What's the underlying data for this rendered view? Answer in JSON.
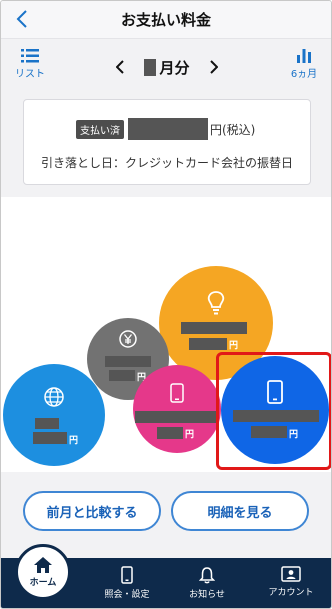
{
  "header": {
    "title": "お支払い料金"
  },
  "monthbar": {
    "list_label": "リスト",
    "month_suffix": "月分",
    "six_label": "6ヵ月"
  },
  "payment": {
    "status_badge": "支払い済",
    "tax_label": "円(税込)",
    "debit_info": "引き落とし日：クレジットカード会社の振替日"
  },
  "bubbles": {
    "yen_symbol": "円",
    "icons": [
      "lightbulb-icon",
      "yen-coin-icon",
      "smartphone-icon",
      "globe-icon",
      "smartphone-icon"
    ],
    "colors": {
      "electricity": "#f5a623",
      "other": "#727272",
      "mobile_small": "#e5388a",
      "internet": "#1d8fe0",
      "mobile_large": "#0f66e6"
    }
  },
  "buttons": {
    "compare": "前月と比較する",
    "detail": "明細を見る"
  },
  "nav": {
    "home": "ホーム",
    "inquiry": "照会・設定",
    "notice": "お知らせ",
    "account": "アカウント"
  },
  "colors": {
    "accent": "#1a73c8",
    "nav_bg": "#0e2a4b",
    "highlight": "#e11818"
  }
}
